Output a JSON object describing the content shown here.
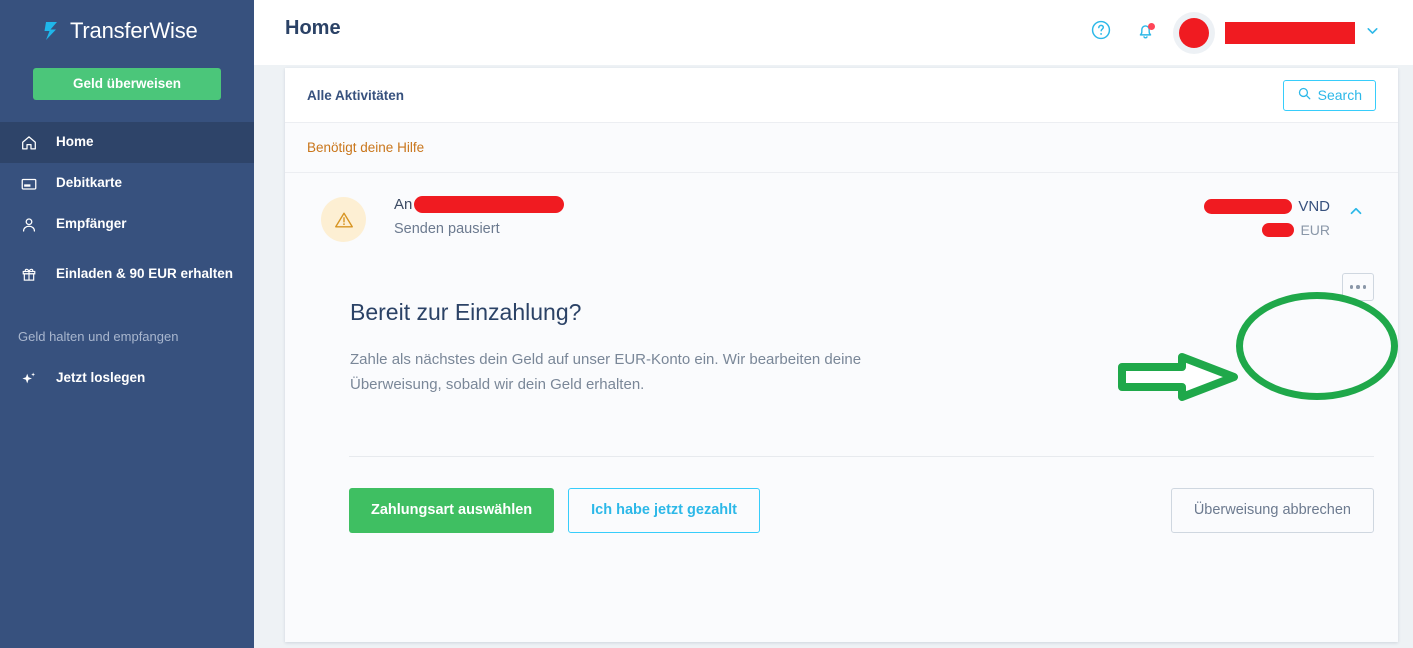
{
  "sidebar": {
    "brand": {
      "name": "TransferWise",
      "logo_icon": "transferwise-logo-icon"
    },
    "cta_label": "Geld überweisen",
    "items": [
      {
        "label": "Home",
        "icon": "home-icon",
        "active": true
      },
      {
        "label": "Debitkarte",
        "icon": "card-icon",
        "active": false
      },
      {
        "label": "Empfänger",
        "icon": "person-icon",
        "active": false
      },
      {
        "label": "Einladen & 90 EUR erhalten",
        "icon": "gift-icon",
        "active": false
      }
    ],
    "section_label": "Geld halten und empfangen",
    "secondary_items": [
      {
        "label": "Jetzt loslegen",
        "icon": "sparkle-icon"
      }
    ],
    "colors": {
      "bg": "#37517e",
      "active_bg": "#2e4469",
      "cta": "#4bc67a"
    }
  },
  "topbar": {
    "title": "Home",
    "help_icon": "question-circle-icon",
    "notifications_icon": "bell-icon",
    "notification_dot": true,
    "avatar_icon": "avatar",
    "user_name": "",
    "chevron_icon": "chevron-down-icon"
  },
  "card": {
    "head_title": "Alle Aktivitäten",
    "search_label": "Search",
    "search_icon": "search-icon",
    "section_label": "Benötigt deine Hilfe",
    "transaction": {
      "status_icon": "warning-triangle-icon",
      "recipient_prefix": "An",
      "recipient_redacted": true,
      "status_text": "Senden pausiert",
      "amount_primary_currency": "VND",
      "amount_secondary_currency": "EUR",
      "collapse_icon": "chevron-up-icon"
    },
    "detail": {
      "title": "Bereit zur Einzahlung?",
      "body": "Zahle als nächstes dein Geld auf unser EUR-Konto ein. Wir bearbeiten deine Überweisung, sobald wir dein Geld erhalten.",
      "more_icon": "ellipsis-icon"
    },
    "actions": {
      "primary_label": "Zahlungsart auswählen",
      "secondary_label": "Ich habe jetzt gezahlt",
      "cancel_label": "Überweisung abbrechen"
    }
  },
  "annotations": {
    "ellipse": {
      "shape": "ellipse-highlight",
      "color": "#1fa84a"
    },
    "arrow": {
      "shape": "arrow-right-annotation",
      "color": "#1fa84a"
    }
  },
  "colors": {
    "accent_blue": "#37cdfb",
    "brand_navy": "#37517e",
    "green": "#3fbf62",
    "warning_orange": "#c9761b",
    "redaction_red": "#f01b21",
    "page_bg": "#eef2f5"
  }
}
